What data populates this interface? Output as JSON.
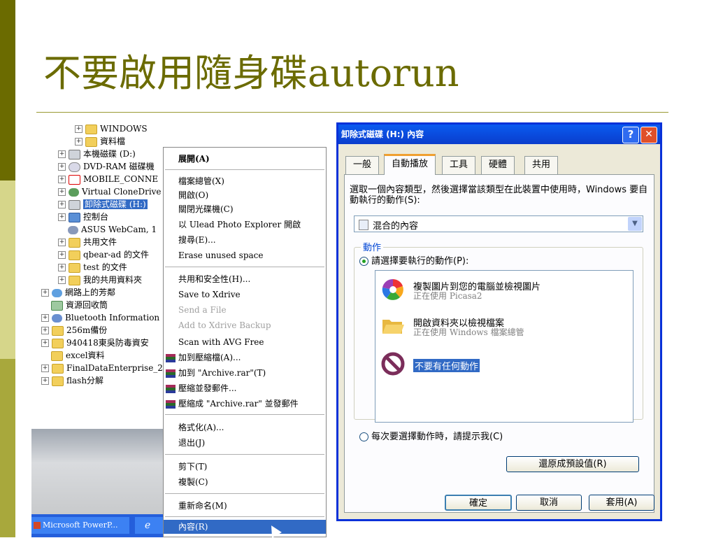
{
  "slide": {
    "title": "不要啟用隨身碟autorun"
  },
  "explorer": {
    "items": [
      {
        "label": "WINDOWS",
        "icon": "folder-icon"
      },
      {
        "label": "資料檔",
        "icon": "folder-icon"
      },
      {
        "label": "本機磁碟 (D:)",
        "icon": "drive-icon"
      },
      {
        "label": "DVD-RAM 磁碟機",
        "icon": "cd-drive-icon"
      },
      {
        "label": "MOBILE_CONNE",
        "icon": "mobile-drive-icon"
      },
      {
        "label": "Virtual CloneDrive",
        "icon": "virtual-drive-icon"
      },
      {
        "label": "卸除式磁碟 (H:)",
        "icon": "removable-drive-icon"
      },
      {
        "label": "控制台",
        "icon": "control-panel-icon"
      },
      {
        "label": "ASUS WebCam, 1",
        "icon": "webcam-icon"
      },
      {
        "label": "共用文件",
        "icon": "folder-icon"
      },
      {
        "label": "qbear-ad 的文件",
        "icon": "folder-icon"
      },
      {
        "label": "test 的文件",
        "icon": "folder-icon"
      },
      {
        "label": "我的共用資料夾",
        "icon": "shared-folder-icon"
      },
      {
        "label": "網路上的芳鄰",
        "icon": "network-icon"
      },
      {
        "label": "資源回收筒",
        "icon": "recycle-bin-icon"
      },
      {
        "label": "Bluetooth Information",
        "icon": "bluetooth-icon"
      },
      {
        "label": "256m備份",
        "icon": "folder-icon"
      },
      {
        "label": "940418東吳防毒資安",
        "icon": "folder-icon"
      },
      {
        "label": "excel資料",
        "icon": "folder-icon"
      },
      {
        "label": "FinalDataEnterprise_2",
        "icon": "folder-icon"
      },
      {
        "label": "flash分解",
        "icon": "folder-icon"
      }
    ]
  },
  "taskbar": {
    "task1": "Microsoft PowerP...",
    "task2": "ℯ"
  },
  "context_menu": {
    "items": [
      "展開(A)",
      "檔案總管(X)",
      "開啟(O)",
      "關閉光碟機(C)",
      "以 Ulead Photo Explorer 開啟",
      "搜尋(E)...",
      "Erase unused space",
      "共用和安全性(H)...",
      "Save to Xdrive",
      "Send a File",
      "Add to Xdrive Backup",
      "Scan with AVG Free",
      "加到壓縮檔(A)...",
      "加到 \"Archive.rar\"(T)",
      "壓縮並發郵件...",
      "壓縮成 \"Archive.rar\" 並發郵件",
      "格式化(A)...",
      "退出(J)",
      "剪下(T)",
      "複製(C)",
      "重新命名(M)",
      "內容(R)"
    ]
  },
  "dialog": {
    "title": "卸除式磁碟 (H:) 內容",
    "help_glyph": "?",
    "close_glyph": "✕",
    "tabs": [
      "一般",
      "自動播放",
      "工具",
      "硬體",
      "共用"
    ],
    "description": "選取一個內容類型，然後選擇當該類型在此裝置中使用時，Windows 要自動執行的動作(S):",
    "content_type": "混合的內容",
    "group_label": "動作",
    "radio_choose": "請選擇要執行的動作(P):",
    "actions": [
      {
        "title": "複製圖片到您的電腦並檢視圖片",
        "sub": "正在使用 Picasa2"
      },
      {
        "title": "開啟資料夾以檢視檔案",
        "sub": "正在使用 Windows 檔案總管"
      },
      {
        "title": "不要有任何動作",
        "sub": ""
      }
    ],
    "radio_prompt": "每次要選擇動作時，請提示我(C)",
    "restore_button": "還原成預設值(R)",
    "ok_button": "確定",
    "cancel_button": "取消",
    "apply_button": "套用(A)",
    "combo_arrow": "▼"
  },
  "colors": {
    "accent": "#6b6b00",
    "selection": "#316ac5",
    "titlebar": "#0a46e0"
  }
}
